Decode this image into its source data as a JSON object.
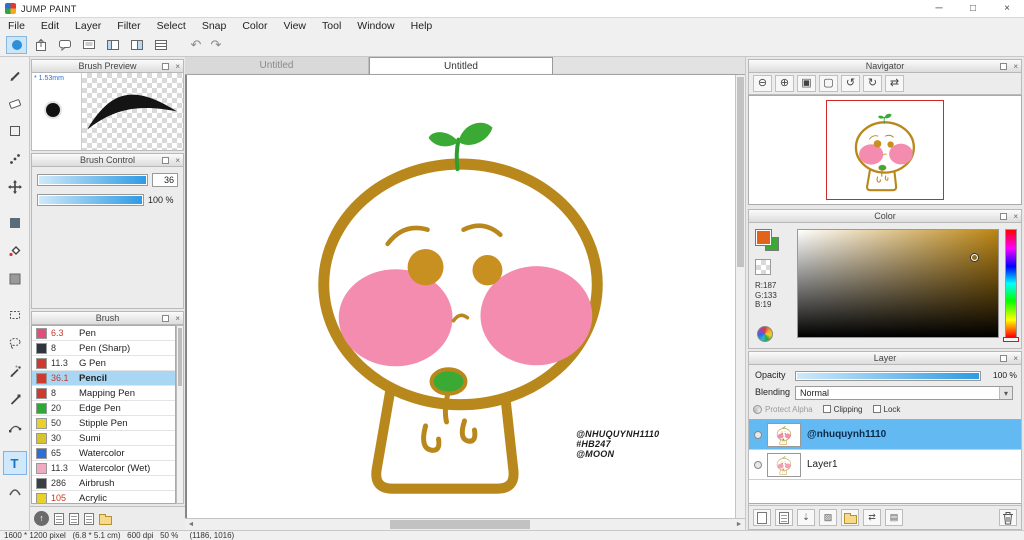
{
  "window": {
    "title": "JUMP PAINT",
    "menu": [
      "File",
      "Edit",
      "Layer",
      "Filter",
      "Select",
      "Snap",
      "Color",
      "View",
      "Tool",
      "Window",
      "Help"
    ],
    "controls": {
      "minimize": "─",
      "maximize": "□",
      "close": "×"
    }
  },
  "toolbar": {
    "undo": "↶",
    "redo": "↷"
  },
  "tabs": [
    {
      "label": "Untitled"
    },
    {
      "label": "Untitled"
    }
  ],
  "panels": {
    "brush_preview": {
      "title": "Brush Preview",
      "size_label": "* 1.53mm"
    },
    "brush_control": {
      "title": "Brush Control",
      "size_value": "36",
      "opacity_value": "100 %"
    },
    "brush": {
      "title": "Brush",
      "items": [
        {
          "size": "6.3",
          "name": "Pen",
          "color": "#e0507a",
          "size_color": "#c0392b"
        },
        {
          "size": "8",
          "name": "Pen (Sharp)",
          "color": "#2e3440",
          "size_color": "#333333"
        },
        {
          "size": "11.3",
          "name": "G Pen",
          "color": "#d03a2e",
          "size_color": "#333333"
        },
        {
          "size": "36.1",
          "name": "Pencil",
          "color": "#d03a2e",
          "size_color": "#c0392b"
        },
        {
          "size": "8",
          "name": "Mapping Pen",
          "color": "#d03a2e",
          "size_color": "#333333"
        },
        {
          "size": "20",
          "name": "Edge Pen",
          "color": "#2ea836",
          "size_color": "#333333"
        },
        {
          "size": "50",
          "name": "Stipple Pen",
          "color": "#e8d22a",
          "size_color": "#333333"
        },
        {
          "size": "30",
          "name": "Sumi",
          "color": "#d9c32b",
          "size_color": "#333333"
        },
        {
          "size": "65",
          "name": "Watercolor",
          "color": "#2f6fd4",
          "size_color": "#333333"
        },
        {
          "size": "11.3",
          "name": "Watercolor (Wet)",
          "color": "#f2a9c4",
          "size_color": "#333333"
        },
        {
          "size": "286",
          "name": "Airbrush",
          "color": "#3a3f46",
          "size_color": "#333333"
        },
        {
          "size": "105",
          "name": "Acrylic",
          "color": "#e8d22a",
          "size_color": "#c0392b"
        }
      ]
    },
    "navigator": {
      "title": "Navigator",
      "icons": {
        "zoom_out": "⊖",
        "zoom_in": "⊕",
        "fit": "▣",
        "actual": "▢",
        "rotate_left": "↺",
        "rotate_right": "↻",
        "flip": "⇄"
      }
    },
    "color": {
      "title": "Color",
      "r": "R:187",
      "g": "G:133",
      "b": "B:19",
      "current": "#bb8513",
      "fg": "#e2641c",
      "bg_swatch": "#3aaa35"
    },
    "layer": {
      "title": "Layer",
      "opacity_label": "Opacity",
      "opacity_value": "100 %",
      "blending_label": "Blending",
      "blending_value": "Normal",
      "protect_alpha": "Protect Alpha",
      "clipping": "Clipping",
      "lock": "Lock",
      "layers": [
        {
          "name": "@nhuquynh1110"
        },
        {
          "name": "Layer1"
        }
      ]
    }
  },
  "canvas": {
    "annotation_lines": [
      "@NHUQUYNH1110",
      "#HB247",
      "@MOON"
    ]
  },
  "status_bar": {
    "text": "1600 * 1200 pixel   (6.8 * 5.1 cm)   600 dpi   50 %     (1186, 1016)"
  },
  "art_colors": {
    "outline": "#b9881c",
    "cheek": "#f48caf",
    "leaf": "#3aaa35",
    "eye": "#c89020"
  }
}
